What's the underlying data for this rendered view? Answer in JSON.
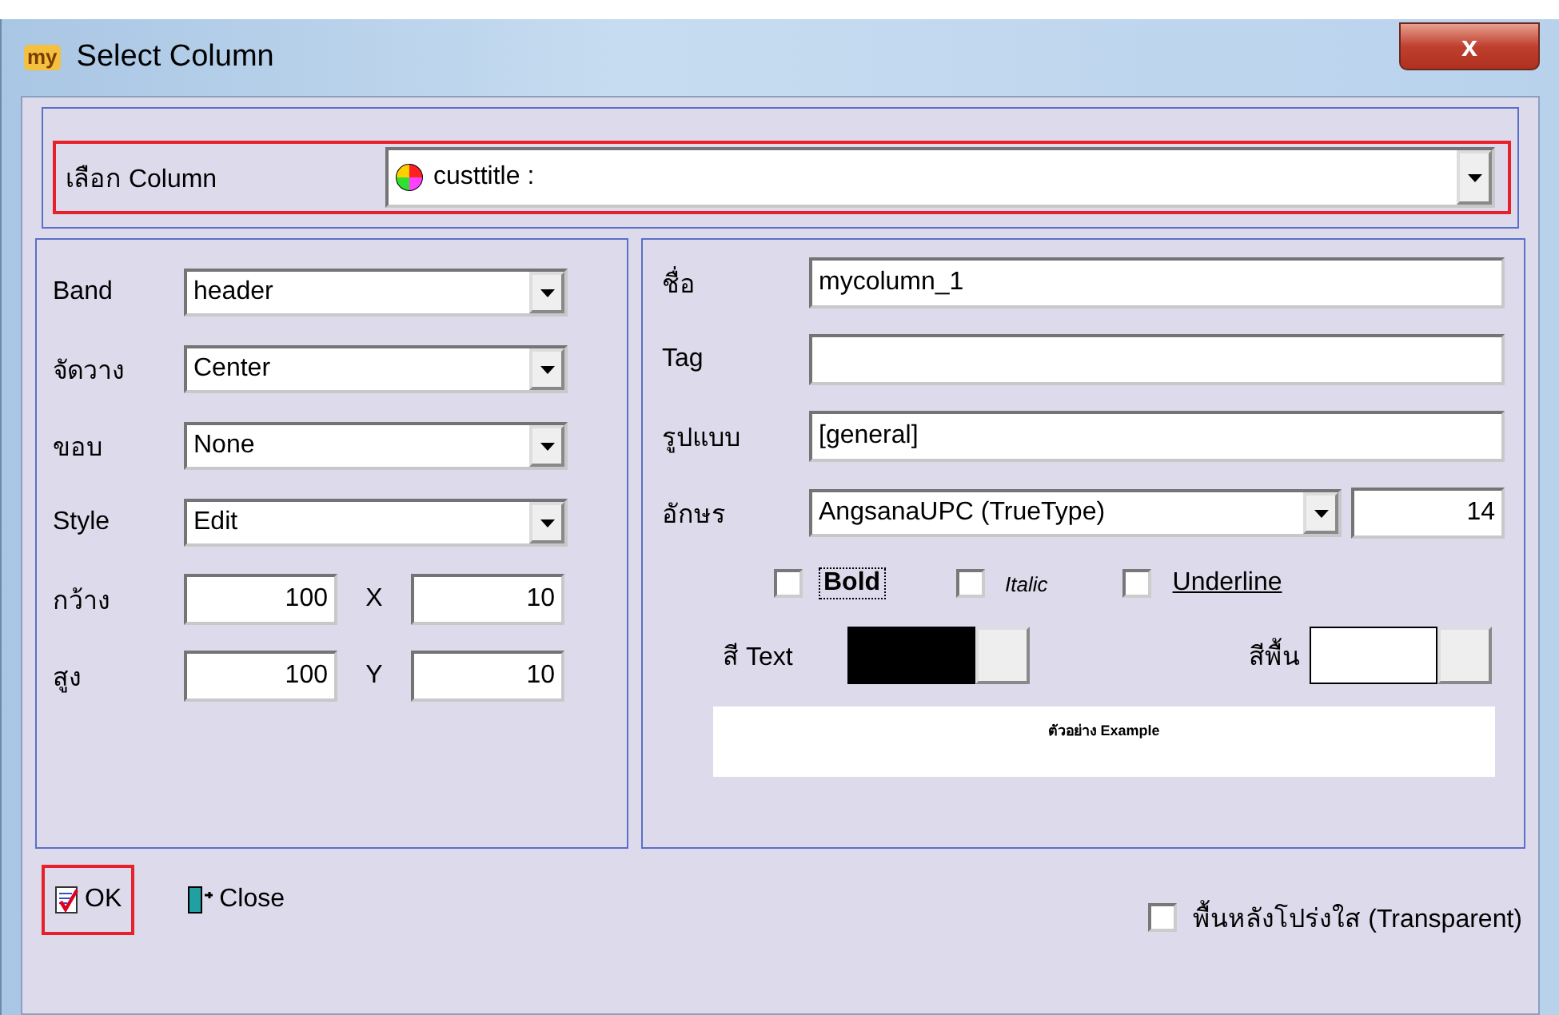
{
  "window": {
    "title": "Select Column",
    "app_icon": "my",
    "close": "x"
  },
  "column_picker": {
    "label": "เลือก Column",
    "value": "custtitle :",
    "highlighted": true
  },
  "left_fields": [
    {
      "kind": "combo",
      "label": "Band",
      "value": "header"
    },
    {
      "kind": "combo",
      "label": "จัดวาง",
      "value": "Center"
    },
    {
      "kind": "combo",
      "label": "ขอบ",
      "value": "None"
    },
    {
      "kind": "combo",
      "label": "Style",
      "value": "Edit"
    },
    {
      "kind": "pair",
      "label": "กว้าง",
      "value": "100",
      "label_2": "X",
      "value_2": "10"
    },
    {
      "kind": "pair",
      "label": "สูง",
      "value": "100",
      "label_2": "Y",
      "value_2": "10"
    }
  ],
  "right_fields": [
    {
      "kind": "text",
      "label": "ชื่อ",
      "value": "mycolumn_1"
    },
    {
      "kind": "text",
      "label": "Tag"
    },
    {
      "kind": "text",
      "label": "รูปแบบ",
      "value": "[general]"
    },
    {
      "kind": "font",
      "label": "อักษร",
      "value": "AngsanaUPC (TrueType)",
      "size": "14"
    }
  ],
  "styles": [
    {
      "kind": "bold",
      "label": "Bold",
      "checked": false,
      "focused": true
    },
    {
      "kind": "italic",
      "label": "Italic",
      "checked": false,
      "focused": false
    },
    {
      "kind": "underline",
      "label": "Underline",
      "checked": false,
      "focused": false
    }
  ],
  "colors": [
    {
      "label": "สี Text",
      "color": "#000000"
    },
    {
      "label": "สีพื้น",
      "color": "#ffffff"
    }
  ],
  "preview": "ตัวอย่าง Example",
  "buttons": [
    {
      "kind": "ok",
      "label": "OK",
      "highlighted": true
    },
    {
      "kind": "close",
      "label": "Close",
      "highlighted": false
    }
  ],
  "transparent": {
    "label": "พื้นหลังโปร่งใส (Transparent)",
    "checked": false
  }
}
